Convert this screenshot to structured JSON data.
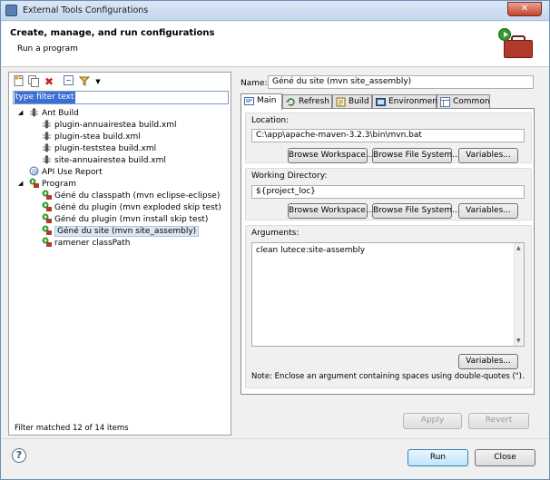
{
  "window": {
    "title": "External Tools Configurations",
    "close_glyph": "✕"
  },
  "header": {
    "title": "Create, manage, and run configurations",
    "subtitle": "Run a program"
  },
  "left": {
    "toolbar": [
      "new-config-icon",
      "duplicate-icon",
      "delete-icon",
      "collapse-all-icon",
      "filter-icon"
    ],
    "filter_text": "type filter text",
    "tree": {
      "ant_build": {
        "label": "Ant Build",
        "children": [
          "plugin-annuairestea build.xml",
          "plugin-stea build.xml",
          "plugin-teststea build.xml",
          "site-annuairestea build.xml"
        ]
      },
      "api_report": "API Use Report",
      "program": {
        "label": "Program",
        "children": [
          "Géné du classpath (mvn eclipse-eclipse)",
          "Géné du plugin (mvn exploded skip test)",
          "Géné du plugin (mvn install skip test)",
          "Géné du site (mvn site_assembly)",
          "ramener classPath"
        ]
      }
    },
    "footer": "Filter matched 12 of 14 items"
  },
  "right": {
    "name_label": "Name:",
    "name_value": "Géné du site (mvn site_assembly)",
    "tabs": [
      "Main",
      "Refresh",
      "Build",
      "Environment",
      "Common"
    ],
    "location": {
      "label": "Location:",
      "value": "C:\\app\\apache-maven-3.2.3\\bin\\mvn.bat",
      "buttons": [
        "Browse Workspace...",
        "Browse File System...",
        "Variables..."
      ]
    },
    "working_dir": {
      "label": "Working Directory:",
      "value": "${project_loc}",
      "buttons": [
        "Browse Workspace...",
        "Browse File System...",
        "Variables..."
      ]
    },
    "arguments": {
      "label": "Arguments:",
      "value": "clean lutece:site-assembly",
      "variables_button": "Variables...",
      "note": "Note: Enclose an argument containing spaces using double-quotes (\")."
    },
    "apply": "Apply",
    "revert": "Revert"
  },
  "footer": {
    "run": "Run",
    "close": "Close",
    "help_glyph": "?"
  },
  "colors": {
    "accent": "#3d6fd1",
    "title_bar": "#c4d7ee",
    "close": "#c4432b"
  }
}
